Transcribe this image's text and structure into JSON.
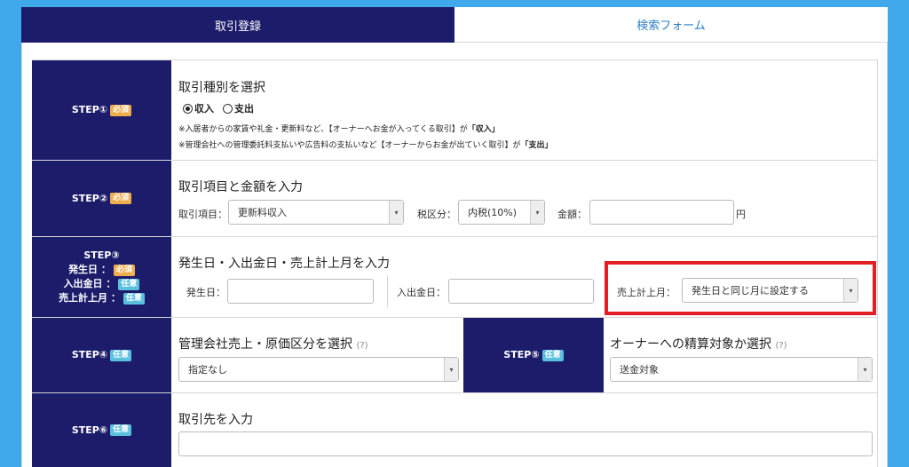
{
  "tabs": [
    {
      "label": "取引登録",
      "active": true
    },
    {
      "label": "検索フォーム",
      "active": false
    }
  ],
  "badges": {
    "required": "必須",
    "optional": "任意"
  },
  "step1": {
    "label": "STEP①",
    "title": "取引種別を選択",
    "options": [
      "収入",
      "支出"
    ],
    "selected": "収入",
    "note1": "※入居者からの家賃や礼金・更新料など、【オーナーへお金が入ってくる取引】が",
    "note1_em": "「収入」",
    "note2": "※管理会社への管理委託料支払いや広告料の支払いなど【オーナーからお金が出ていく取引】が",
    "note2_em": "「支出」"
  },
  "step2": {
    "label": "STEP②",
    "title": "取引項目と金額を入力",
    "item_label": "取引項目：",
    "item_value": "更新料収入",
    "tax_label": "税区分：",
    "tax_value": "内税(10%)",
    "amount_label": "金額：",
    "amount_value": "",
    "amount_unit": "円"
  },
  "step3": {
    "label": "STEP③",
    "sub": [
      {
        "label": "発生日",
        "badge": "必須"
      },
      {
        "label": "入出金日",
        "badge": "任意"
      },
      {
        "label": "売上計上月",
        "badge": "任意"
      }
    ],
    "title": "発生日・入出金日・売上計上月を入力",
    "date_label": "発生日：",
    "date_value": "",
    "cash_label": "入出金日：",
    "cash_value": "",
    "month_label": "売上計上月：",
    "month_value": "発生日と同じ月に設定する"
  },
  "step4": {
    "label": "STEP④",
    "title": "管理会社売上・原価区分を選択",
    "help": "(?)",
    "value": "指定なし"
  },
  "step5": {
    "label": "STEP⑤",
    "title": "オーナーへの精算対象か選択",
    "help": "(?)",
    "value": "送金対象"
  },
  "step6": {
    "label": "STEP⑥",
    "title": "取引先を入力",
    "value": ""
  }
}
